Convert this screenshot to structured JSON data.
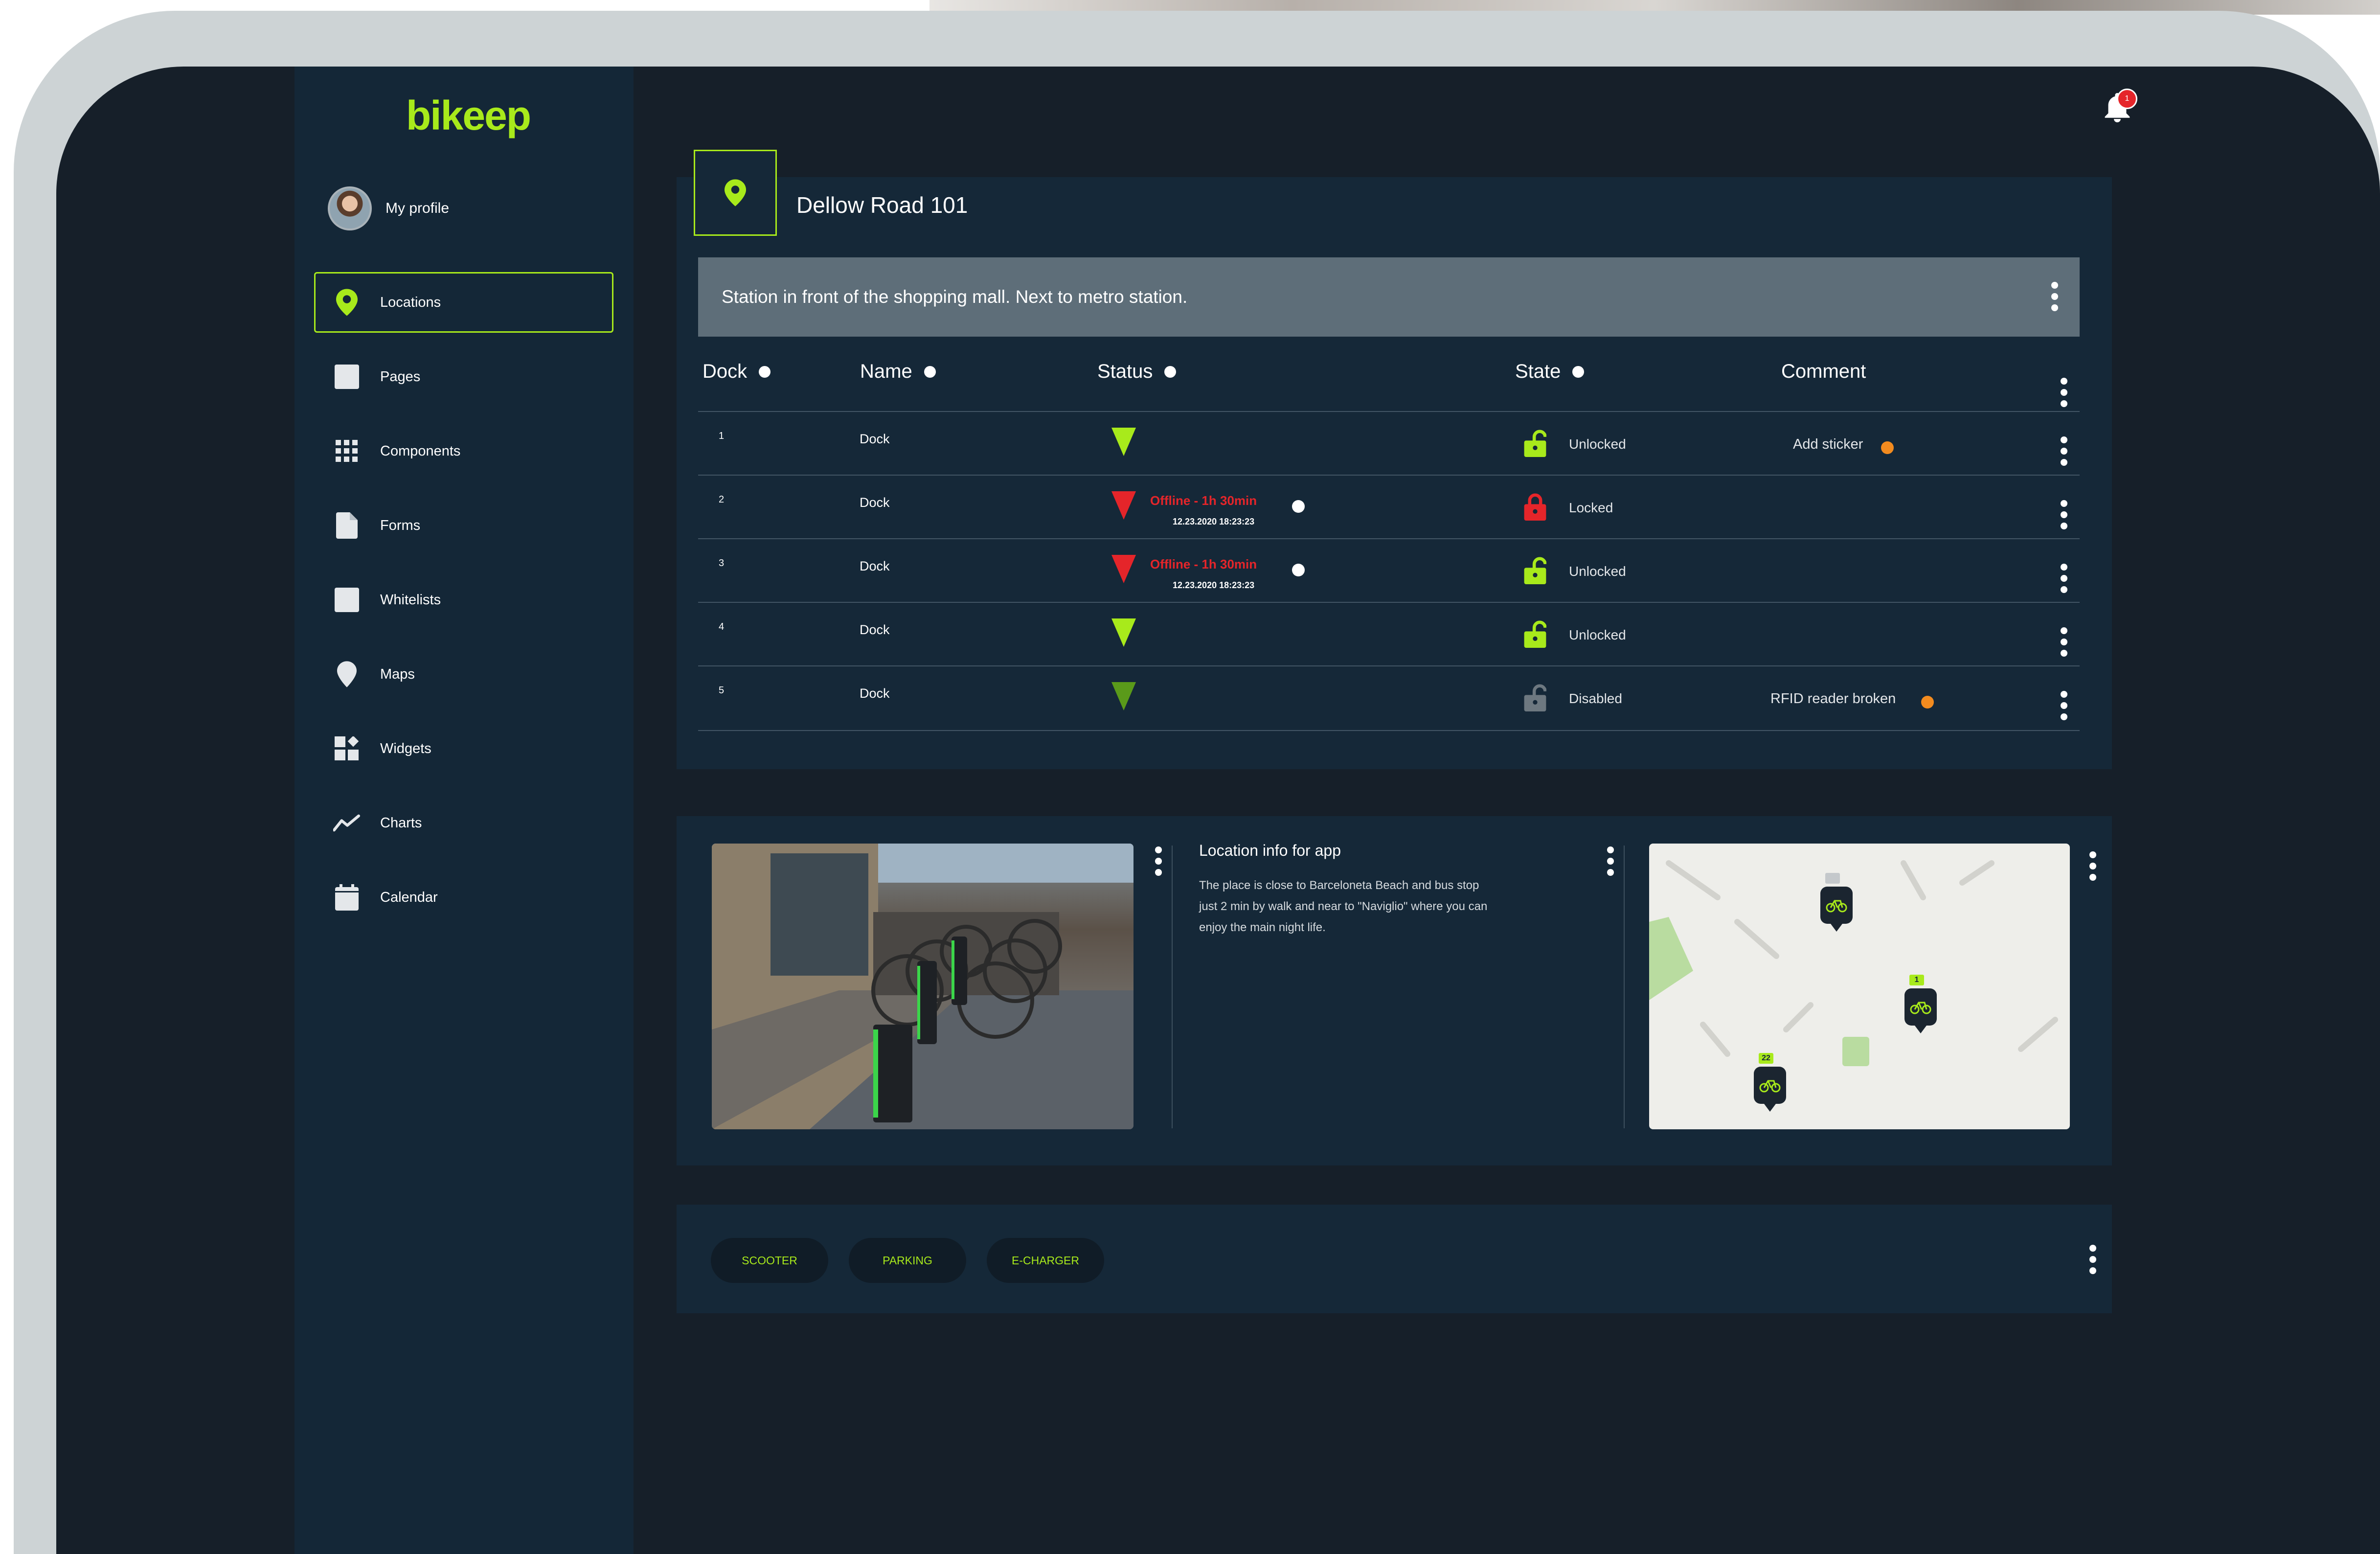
{
  "app": {
    "logo": "bikeep",
    "notifications_count": "1",
    "colors": {
      "accent": "#a8ea1b",
      "panel": "#152838",
      "sidebar": "#142737",
      "error": "#e5252a",
      "comment_dot": "#f28b1f"
    }
  },
  "sidebar": {
    "profile_label": "My profile",
    "items": [
      {
        "label": "Locations",
        "icon": "location-pin-icon",
        "active": true
      },
      {
        "label": "Pages",
        "icon": "pages-icon"
      },
      {
        "label": "Components",
        "icon": "grid-icon"
      },
      {
        "label": "Forms",
        "icon": "document-icon"
      },
      {
        "label": "Whitelists",
        "icon": "whitelist-icon"
      },
      {
        "label": "Maps",
        "icon": "map-pin-icon"
      },
      {
        "label": "Widgets",
        "icon": "widgets-icon"
      },
      {
        "label": "Charts",
        "icon": "line-chart-icon"
      },
      {
        "label": "Calendar",
        "icon": "calendar-icon"
      }
    ]
  },
  "location": {
    "title": "Dellow Road 101",
    "description": "Station in front of the shopping mall. Next to metro station."
  },
  "table": {
    "headers": {
      "dock": "Dock",
      "name": "Name",
      "status": "Status",
      "state": "State",
      "comment": "Comment"
    },
    "rows": [
      {
        "dock": "1",
        "name": "Dock",
        "status": "online",
        "offline_text": "",
        "offline_time": "",
        "state": "Unlocked",
        "comment": "Add sticker"
      },
      {
        "dock": "2",
        "name": "Dock",
        "status": "offline",
        "offline_text": "Offline - 1h 30min",
        "offline_time": "12.23.2020 18:23:23",
        "state": "Locked",
        "comment": ""
      },
      {
        "dock": "3",
        "name": "Dock",
        "status": "offline",
        "offline_text": "Offline - 1h 30min",
        "offline_time": "12.23.2020 18:23:23",
        "state": "Unlocked",
        "comment": ""
      },
      {
        "dock": "4",
        "name": "Dock",
        "status": "online",
        "offline_text": "",
        "offline_time": "",
        "state": "Unlocked",
        "comment": ""
      },
      {
        "dock": "5",
        "name": "Dock",
        "status": "disabled",
        "offline_text": "",
        "offline_time": "",
        "state": "Disabled",
        "comment": "RFID reader broken"
      }
    ]
  },
  "app_info": {
    "title": "Location info for app",
    "text": "The place is close to Barceloneta Beach and bus stop just 2 min by walk and near to \"Naviglio\" where you can enjoy the main night life."
  },
  "map": {
    "markers": [
      {
        "badge": "",
        "icon": "bicycle-icon"
      },
      {
        "badge": "1",
        "icon": "bicycle-icon"
      },
      {
        "badge": "22",
        "icon": "bicycle-icon"
      }
    ]
  },
  "services": {
    "chips": [
      "SCOOTER",
      "PARKING",
      "E-CHARGER"
    ]
  }
}
